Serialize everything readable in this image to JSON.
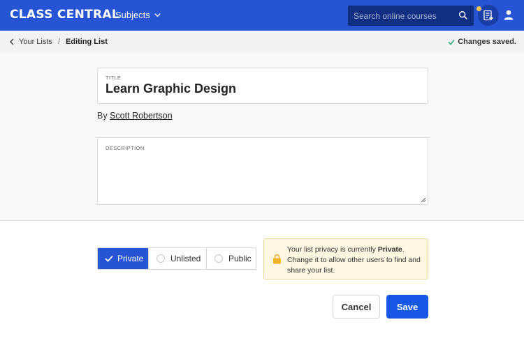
{
  "header": {
    "logo_text": "CLASS CENTRAL",
    "subjects_label": "Subjects",
    "search_placeholder": "Search online courses"
  },
  "breadcrumb": {
    "back_label": "Your Lists",
    "separator": "/",
    "current_label": "Editing List",
    "status_text": "Changes saved."
  },
  "form": {
    "title_label": "TITLE",
    "title_value": "Learn Graphic Design",
    "by_prefix": "By",
    "author_name": "Scott Robertson",
    "description_label": "DESCRIPTION",
    "description_value": ""
  },
  "privacy": {
    "options": [
      "Private",
      "Unlisted",
      "Public"
    ],
    "selected": "Private",
    "notice_prefix": "Your list privacy is currently ",
    "notice_value": "Private",
    "notice_suffix": ". Change it to allow other users to find and share your list."
  },
  "actions": {
    "cancel_label": "Cancel",
    "save_label": "Save"
  },
  "colors": {
    "brand": "#2654d4",
    "save": "#1657e6",
    "notice_bg": "#fff6e2",
    "notice_icon": "#f0b323",
    "saved_check": "#2aa876"
  }
}
